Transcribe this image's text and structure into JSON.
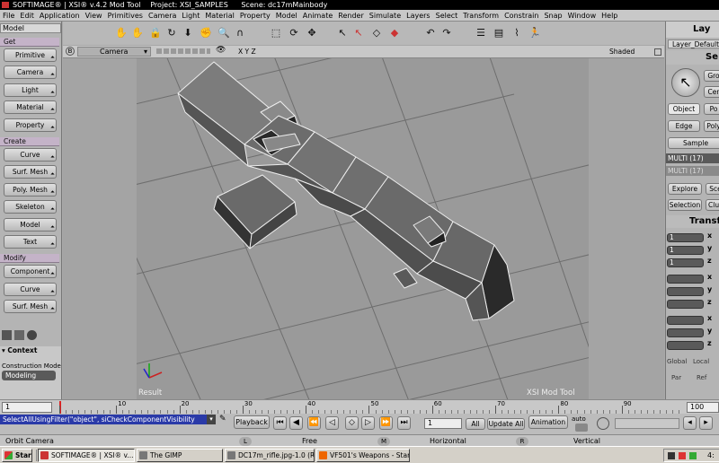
{
  "window": {
    "app_title": "SOFTIMAGE® | XSI® v.4.2 Mod Tool",
    "project": "Project: XSI_SAMPLES",
    "scene": "Scene: dc17mMainbody"
  },
  "menu": [
    "File",
    "Edit",
    "Application",
    "View",
    "Primitives",
    "Camera",
    "Light",
    "Material",
    "Property",
    "Model",
    "Animate",
    "Render",
    "Simulate",
    "Layers",
    "Select",
    "Transform",
    "Constrain",
    "Snap",
    "Window",
    "Help"
  ],
  "left_panel": {
    "mode": "Model",
    "sections": [
      {
        "title": "Get",
        "buttons": [
          "Primitive",
          "Camera",
          "Light",
          "Material",
          "Property"
        ]
      },
      {
        "title": "Create",
        "buttons": [
          "Curve",
          "Surf. Mesh",
          "Poly. Mesh",
          "Skeleton",
          "Model",
          "Text"
        ]
      },
      {
        "title": "Modify",
        "buttons": [
          "Component",
          "Curve",
          "Surf. Mesh"
        ]
      }
    ],
    "context_label": "▾ Context",
    "construction_mode_label": "Construction Mode",
    "construction_mode_value": "Modeling"
  },
  "viewport": {
    "letter": "B",
    "camera": "Camera",
    "axes": "X Y Z",
    "shading": "Shaded",
    "result_label": "Result",
    "watermark": "XSI Mod Tool"
  },
  "right_panel": {
    "layer_title": "Lay",
    "layer_default": "Layer_Default",
    "select_title": "Se",
    "group_btn": "Gro",
    "center_btn": "Cer",
    "object_btn": "Object",
    "point_btn": "Po",
    "edge_btn": "Edge",
    "poly_btn": "Poly",
    "sample_btn": "Sample",
    "multi1": "MULTI (17)",
    "multi2": "MULTI (17)",
    "explore_btn": "Explore",
    "scene_btn": "Sce",
    "selection_btn": "Selection",
    "clusters_btn": "Clus",
    "transform_title": "Transf",
    "scale_values": [
      "1",
      "1",
      "1"
    ],
    "axis_labels": [
      "x",
      "y",
      "z"
    ],
    "global_label": "Global",
    "local_label": "Local",
    "par_label": "Par",
    "ref_label": "Ref"
  },
  "timeline": {
    "current_frame": "1",
    "ticks": [
      "1",
      "10",
      "20",
      "30",
      "40",
      "50",
      "60",
      "70",
      "80",
      "90"
    ],
    "end_frame": "100"
  },
  "playbar": {
    "command": "SelectAllUsingFilter(\"object\", siCheckComponentVisibility",
    "playback_btn": "Playback",
    "frame_field": "1",
    "all_btn": "All",
    "update_all_btn": "Update All",
    "animation_btn": "Animation",
    "auto_label": "auto"
  },
  "status": {
    "left_text": "Orbit Camera",
    "l_key": "L",
    "free": "Free",
    "m_key": "M",
    "horizontal": "Horizontal",
    "r_key": "R",
    "vertical": "Vertical"
  },
  "taskbar": {
    "start": "Start",
    "tasks": [
      "SOFTIMAGE® | XSI® v...",
      "The GIMP",
      "DC17m_rifle.jpg-1.0 (RG...",
      "VF501's Weapons - Star ..."
    ],
    "clock": "4:"
  },
  "colors": {
    "section_header": "#c4b3c8",
    "viewport_bg": "#9a9a9a",
    "mesh_dark": "#2a2a2a",
    "mesh_light": "#d8d8d8"
  }
}
